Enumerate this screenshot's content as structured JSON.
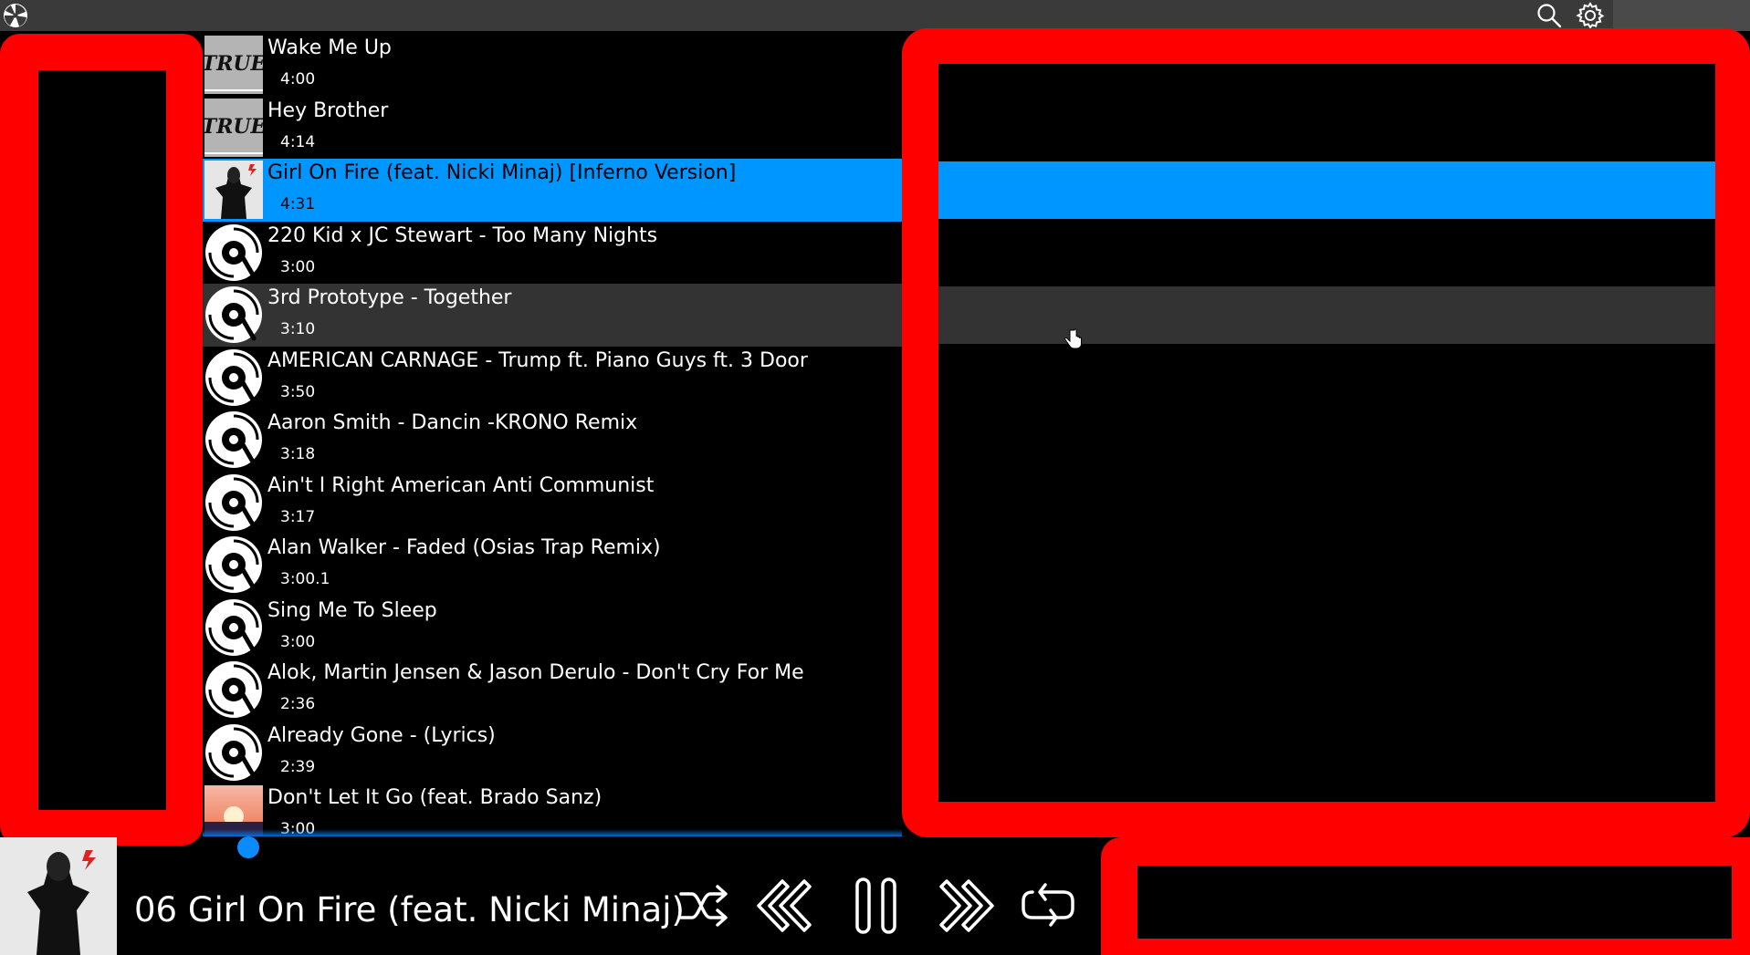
{
  "topbar": {
    "logo_icon": "pinwheel-logo-icon",
    "search_icon": "search-icon",
    "settings_icon": "gear-icon"
  },
  "colors": {
    "accent": "#0096ff",
    "hover_row": "#333333",
    "topbar": "#3a3a3a",
    "overlay_red": "#ff0000"
  },
  "tracks": [
    {
      "title": "Wake Me Up",
      "duration": "4:00",
      "cover": "true-album-art"
    },
    {
      "title": "Hey Brother",
      "duration": "4:14",
      "cover": "true-album-art"
    },
    {
      "title": "Girl On Fire (feat. Nicki Minaj) [Inferno Version]",
      "duration": "4:31",
      "cover": "girl-on-fire-art",
      "state": "playing"
    },
    {
      "title": "220 Kid x JC Stewart - Too Many Nights",
      "duration": "3:00",
      "cover": "disc-icon"
    },
    {
      "title": "3rd Prototype - Together",
      "duration": "3:10",
      "cover": "disc-icon",
      "state": "hover"
    },
    {
      "title": "AMERICAN CARNAGE - Trump ft. Piano Guys ft. 3 Door",
      "duration": "3:50",
      "cover": "disc-icon"
    },
    {
      "title": "Aaron Smith - Dancin -KRONO Remix",
      "duration": "3:18",
      "cover": "disc-icon"
    },
    {
      "title": "Ain't I Right American Anti Communist",
      "duration": "3:17",
      "cover": "disc-icon"
    },
    {
      "title": "Alan Walker - Faded (Osias Trap Remix)",
      "duration": "3:00.1",
      "cover": "disc-icon"
    },
    {
      "title": "Sing Me To Sleep",
      "duration": "3:00",
      "cover": "disc-icon"
    },
    {
      "title": "Alok, Martin Jensen & Jason Derulo - Don't Cry For Me",
      "duration": "2:36",
      "cover": "disc-icon"
    },
    {
      "title": "Already Gone - (Lyrics)",
      "duration": "2:39",
      "cover": "disc-icon"
    },
    {
      "title": "Don't Let It Go (feat. Brado Sanz)",
      "duration": "3:00",
      "cover": "sunset-album-art"
    }
  ],
  "player": {
    "now_playing": "06 Girl On Fire (feat. Nicki Minaj)",
    "progress_fraction": 0.05,
    "controls": [
      "shuffle-icon",
      "previous-icon",
      "pause-icon",
      "next-icon",
      "repeat-icon"
    ]
  }
}
